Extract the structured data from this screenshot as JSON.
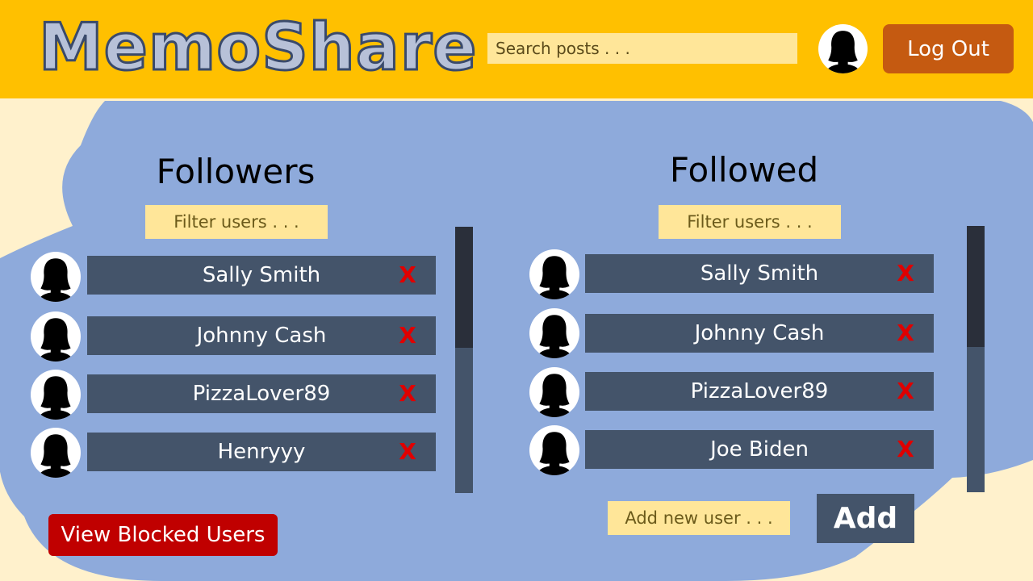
{
  "app": {
    "title": "MemoShare"
  },
  "header": {
    "search_placeholder": "Search posts . . .",
    "avatar_icon": "user-avatar-icon",
    "logout_label": "Log Out"
  },
  "followers": {
    "title": "Followers",
    "filter_placeholder": "Filter users . . .",
    "users": [
      "Sally Smith",
      "Johnny Cash",
      "PizzaLover89",
      "Henryyy"
    ],
    "remove_label": "X"
  },
  "followed": {
    "title": "Followed",
    "filter_placeholder": "Filter users . . .",
    "users": [
      "Sally Smith",
      "Johnny Cash",
      "PizzaLover89",
      "Joe Biden"
    ],
    "remove_label": "X",
    "add_placeholder": "Add new user . . .",
    "add_label": "Add"
  },
  "footer": {
    "blocked_label": "View Blocked Users"
  },
  "colors": {
    "header": "#ffc000",
    "cloud": "#8eaadb",
    "row": "#44546a",
    "remove": "#e00000",
    "logout": "#c55a11",
    "blocked": "#c00000",
    "input": "#ffe699"
  }
}
